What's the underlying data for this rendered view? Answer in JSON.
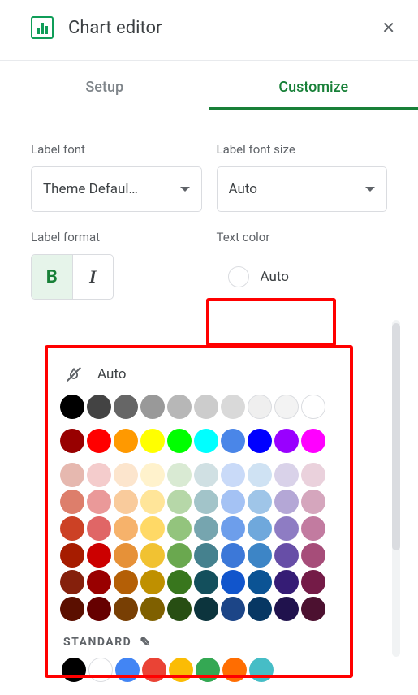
{
  "header": {
    "title": "Chart editor"
  },
  "tabs": {
    "setup": "Setup",
    "customize": "Customize",
    "active": "customize"
  },
  "labels": {
    "labelFont": "Label font",
    "labelFontSize": "Label font size",
    "labelFormat": "Label format",
    "textColor": "Text color"
  },
  "values": {
    "labelFont": "Theme Defaul…",
    "labelFontSize": "Auto",
    "textColor": "Auto"
  },
  "popup": {
    "auto": "Auto",
    "standardLabel": "STANDARD",
    "grays": [
      "#000000",
      "#434343",
      "#666666",
      "#999999",
      "#b7b7b7",
      "#cccccc",
      "#d9d9d9",
      "#efefef",
      "#f3f3f3",
      "#ffffff"
    ],
    "row1": [
      "#980000",
      "#ff0000",
      "#ff9900",
      "#ffff00",
      "#00ff00",
      "#00ffff",
      "#4a86e8",
      "#0000ff",
      "#9900ff",
      "#ff00ff"
    ],
    "tints": [
      [
        "#e6b8af",
        "#f4cccc",
        "#fce5cd",
        "#fff2cc",
        "#d9ead3",
        "#d0e0e3",
        "#c9daf8",
        "#cfe2f3",
        "#d9d2e9",
        "#ead1dc"
      ],
      [
        "#dd7e6b",
        "#ea9999",
        "#f9cb9c",
        "#ffe599",
        "#b6d7a8",
        "#a2c4c9",
        "#a4c2f4",
        "#9fc5e8",
        "#b4a7d6",
        "#d5a6bd"
      ],
      [
        "#cc4125",
        "#e06666",
        "#f6b26b",
        "#ffd966",
        "#93c47d",
        "#76a5af",
        "#6d9eeb",
        "#6fa8dc",
        "#8e7cc3",
        "#c27ba0"
      ],
      [
        "#a61c00",
        "#cc0000",
        "#e69138",
        "#f1c232",
        "#6aa84f",
        "#45818e",
        "#3c78d8",
        "#3d85c6",
        "#674ea7",
        "#a64d79"
      ],
      [
        "#85200c",
        "#990000",
        "#b45f06",
        "#bf9000",
        "#38761d",
        "#134f5c",
        "#1155cc",
        "#0b5394",
        "#351c75",
        "#741b47"
      ],
      [
        "#5b0f00",
        "#660000",
        "#783f04",
        "#7f6000",
        "#274e13",
        "#0c343d",
        "#1c4587",
        "#073763",
        "#20124d",
        "#4c1130"
      ]
    ],
    "standard": [
      "#000000",
      "#ffffff",
      "#4285f4",
      "#ea4335",
      "#fbbc04",
      "#34a853",
      "#ff6d01",
      "#46bdc6"
    ]
  }
}
